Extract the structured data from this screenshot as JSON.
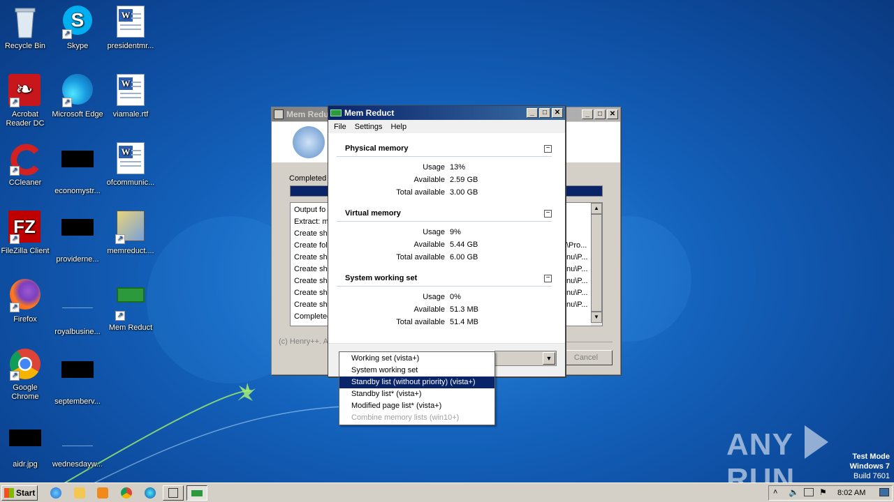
{
  "desktop": {
    "icons": [
      {
        "label": "Recycle Bin"
      },
      {
        "label": "Skype"
      },
      {
        "label": "presidentmr..."
      },
      {
        "label": "Acrobat Reader DC"
      },
      {
        "label": "Microsoft Edge"
      },
      {
        "label": "viamale.rtf"
      },
      {
        "label": "CCleaner"
      },
      {
        "label": "economystr..."
      },
      {
        "label": "ofcommunic..."
      },
      {
        "label": "FileZilla Client"
      },
      {
        "label": "providerne..."
      },
      {
        "label": "memreduct...."
      },
      {
        "label": "Firefox"
      },
      {
        "label": "royalbusine..."
      },
      {
        "label": "Mem Reduct"
      },
      {
        "label": "Google Chrome"
      },
      {
        "label": "septemberv..."
      },
      {
        "label": "aidr.jpg"
      },
      {
        "label": "wednesdayw..."
      }
    ],
    "watermark": {
      "brand": "ANY",
      "brand2": "RUN",
      "line1": "Test Mode",
      "line2": "Windows 7",
      "line3": "Build 7601"
    }
  },
  "installer": {
    "title": "Mem Reduc",
    "status": "Completed",
    "log": [
      {
        "left": "Output fo",
        "right": ""
      },
      {
        "left": "Extract: m",
        "right": ""
      },
      {
        "left": "Create sh",
        "right": ""
      },
      {
        "left": "Create fol",
        "right": "\\Pro..."
      },
      {
        "left": "Create sh",
        "right": "nu\\P..."
      },
      {
        "left": "Create sh",
        "right": "nu\\P..."
      },
      {
        "left": "Create sh",
        "right": "nu\\P..."
      },
      {
        "left": "Create sh",
        "right": "nu\\P..."
      },
      {
        "left": "Create sh",
        "right": "nu\\P..."
      },
      {
        "left": "Completed",
        "right": ""
      }
    ],
    "copyright": "(c) Henry++. A",
    "cancel": "Cancel"
  },
  "memreduct": {
    "title": "Mem Reduct",
    "menu": [
      "File",
      "Settings",
      "Help"
    ],
    "sections": [
      {
        "title": "Physical memory",
        "rows": [
          {
            "label": "Usage",
            "value": "13%"
          },
          {
            "label": "Available",
            "value": "2.59 GB"
          },
          {
            "label": "Total available",
            "value": "3.00 GB"
          }
        ]
      },
      {
        "title": "Virtual memory",
        "rows": [
          {
            "label": "Usage",
            "value": "9%"
          },
          {
            "label": "Available",
            "value": "5.44 GB"
          },
          {
            "label": "Total available",
            "value": "6.00 GB"
          }
        ]
      },
      {
        "title": "System working set",
        "rows": [
          {
            "label": "Usage",
            "value": "0%"
          },
          {
            "label": "Available",
            "value": "51.3 MB"
          },
          {
            "label": "Total available",
            "value": "51.4 MB"
          }
        ]
      }
    ],
    "dropdown": {
      "items": [
        {
          "label": "Working set (vista+)",
          "state": "normal"
        },
        {
          "label": "System working set",
          "state": "normal"
        },
        {
          "label": "Standby list (without priority) (vista+)",
          "state": "selected"
        },
        {
          "label": "Standby list* (vista+)",
          "state": "normal"
        },
        {
          "label": "Modified page list* (vista+)",
          "state": "normal"
        },
        {
          "label": "Combine memory lists (win10+)",
          "state": "disabled"
        }
      ]
    }
  },
  "taskbar": {
    "start": "Start",
    "clock": "8:02 AM"
  },
  "colors": {
    "accent": "#0a246a",
    "desktop": "#1463bd"
  }
}
